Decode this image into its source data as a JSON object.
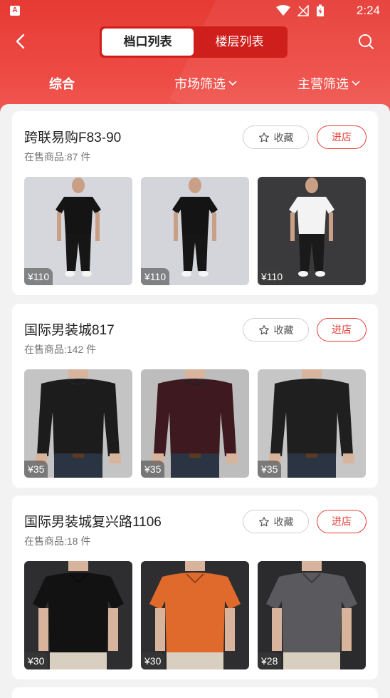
{
  "status_bar": {
    "time": "2:24",
    "app_badge": "A"
  },
  "header": {
    "segments": [
      "档口列表",
      "楼层列表"
    ],
    "filters": [
      {
        "label": "综合"
      },
      {
        "label": "市场筛选"
      },
      {
        "label": "主营筛选"
      }
    ]
  },
  "stores": [
    {
      "name": "跨联易购F83-90",
      "count": "在售商品:87 件",
      "fav": "收藏",
      "enter": "进店",
      "items": [
        {
          "price": "¥110",
          "top": "#141414",
          "bottom": "#161616",
          "bg": "#d5d7dc",
          "style": "tee"
        },
        {
          "price": "¥110",
          "top": "#141414",
          "bottom": "#161616",
          "bg": "#d3d5db",
          "style": "tee"
        },
        {
          "price": "¥110",
          "top": "#f3f3f3",
          "bottom": "#1a1a1a",
          "bg": "#3a3a3c",
          "style": "tee"
        }
      ]
    },
    {
      "name": "国际男装城817",
      "count": "在售商品:142 件",
      "fav": "收藏",
      "enter": "进店",
      "items": [
        {
          "price": "¥35",
          "top": "#1c1c1c",
          "bottom": "#2b3442",
          "bg": "#c4c4c4",
          "style": "long"
        },
        {
          "price": "¥35",
          "top": "#3e1a20",
          "bottom": "#2b3442",
          "bg": "#bdbdbd",
          "style": "long"
        },
        {
          "price": "¥35",
          "top": "#1f1f1f",
          "bottom": "#2b3442",
          "bg": "#c6c6c6",
          "style": "long"
        }
      ]
    },
    {
      "name": "国际男装城复兴路1106",
      "count": "在售商品:18 件",
      "fav": "收藏",
      "enter": "进店",
      "items": [
        {
          "price": "¥30",
          "top": "#121212",
          "bottom": "#d9cfc0",
          "bg": "#2e2e30",
          "style": "polo"
        },
        {
          "price": "¥30",
          "top": "#e06a2c",
          "bottom": "#d9cfc0",
          "bg": "#2e2e30",
          "style": "polo"
        },
        {
          "price": "¥28",
          "top": "#5a5a5e",
          "bottom": "#d9cfc0",
          "bg": "#2b2b2d",
          "style": "polo"
        }
      ]
    }
  ]
}
